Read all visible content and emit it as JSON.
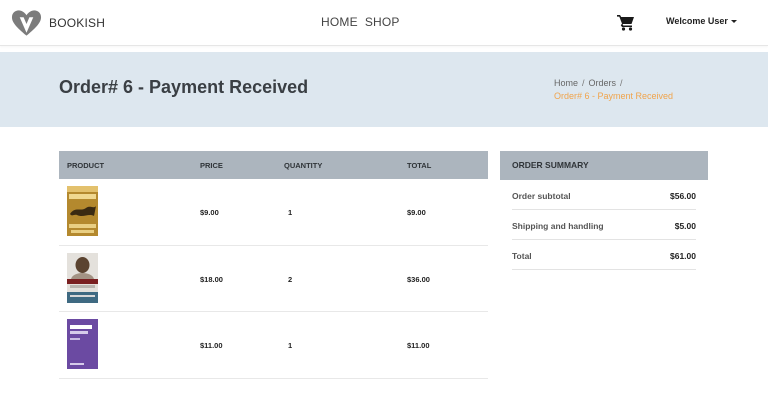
{
  "navbar": {
    "brand": "BOOKISH",
    "links": [
      "HOME",
      "SHOP"
    ],
    "user": "Welcome User"
  },
  "hero": {
    "title": "Order# 6 - Payment Received",
    "breadcrumb": [
      "Home",
      "Orders"
    ],
    "breadcrumb_active": "Order# 6 - Payment Received"
  },
  "table": {
    "headers": [
      "PRODUCT",
      "PRICE",
      "QUANTITY",
      "TOTAL"
    ],
    "rows": [
      {
        "price": "$9.00",
        "quantity": "1",
        "total": "$9.00",
        "cover": "book-cover-dragon"
      },
      {
        "price": "$18.00",
        "quantity": "2",
        "total": "$36.00",
        "cover": "book-cover-portrait"
      },
      {
        "price": "$11.00",
        "quantity": "1",
        "total": "$11.00",
        "cover": "book-cover-bootstrap"
      }
    ]
  },
  "summary": {
    "title": "ORDER SUMMARY",
    "rows": [
      {
        "label": "Order subtotal",
        "value": "$56.00"
      },
      {
        "label": "Shipping and handling",
        "value": "$5.00"
      },
      {
        "label": "Total",
        "value": "$61.00"
      }
    ]
  },
  "colors": {
    "hero_bg": "#dde7ef",
    "table_header_bg": "#acb5be",
    "breadcrumb_active": "#f0a44c"
  }
}
